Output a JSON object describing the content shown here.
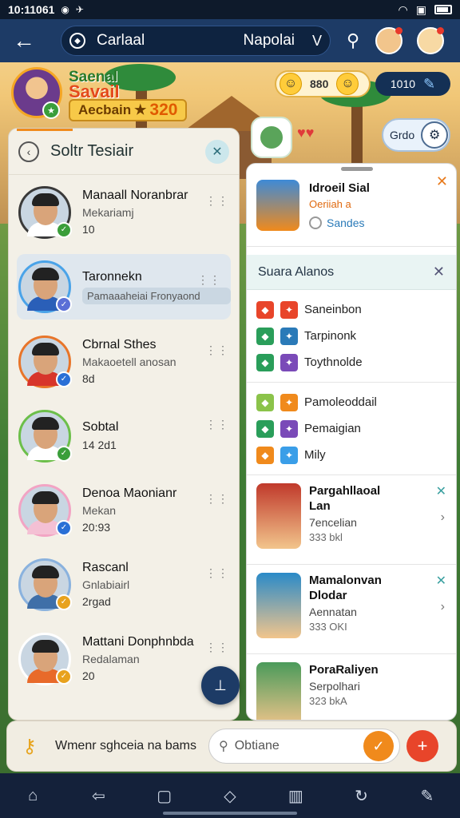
{
  "status_bar": {
    "time": "10:11061"
  },
  "app_bar": {
    "search_left": "Carlaal",
    "search_right": "Napolai",
    "chevron": "V"
  },
  "hud": {
    "name_line1": "Saenal",
    "name_line2": "Savail",
    "level_label": "Aecbain",
    "score": "320",
    "coins": "880",
    "gems": "1010",
    "grid_label": "Grdo",
    "colors": {
      "accent": "#f08a1c",
      "level": "#f7c948"
    }
  },
  "left_panel": {
    "title": "Soltr Tesiair",
    "contacts": [
      {
        "name": "Manaall Noranbrar",
        "sub": "Mekariamj",
        "meta": "10",
        "status_color": "#3a9e3a",
        "ring": "#3a3a3a",
        "shirt": "#ffffff"
      },
      {
        "name": "Taronnekn",
        "sub": "Pamaaaheiai Fronyaond",
        "meta": "",
        "status_color": "#5a6fd6",
        "ring": "#4aa3e8",
        "shirt": "#2a5fb8"
      },
      {
        "name": "Cbrnal Sthes",
        "sub": "Makaoetell anosan",
        "meta": "8d",
        "status_color": "#2a6fd6",
        "ring": "#e8752a",
        "shirt": "#d7352b"
      },
      {
        "name": "Sobtal",
        "sub": "",
        "meta": "14 2d1",
        "status_color": "#3a9e3a",
        "ring": "#6cbf4a",
        "shirt": "#ffffff"
      },
      {
        "name": "Denoa Maonianr",
        "sub": "Mekan",
        "meta": "20:93",
        "status_color": "#2a6fd6",
        "ring": "#f2a4c4",
        "shirt": "#f4c0d4"
      },
      {
        "name": "Rascanl",
        "sub": "Gnlabiairl",
        "meta": "2rgad",
        "status_color": "#e8a21e",
        "ring": "#8ab2de",
        "shirt": "#3f6fa8"
      },
      {
        "name": "Mattani Donphnbda",
        "sub": "Redalaman",
        "meta": "20",
        "status_color": "#e8a21e",
        "ring": "#ffffff",
        "shirt": "#e86a2a"
      }
    ]
  },
  "right_panel": {
    "top": {
      "title": "Idroeil Sial",
      "sub": "Oeriiah a",
      "tag": "Sandes"
    },
    "section_title": "Suara Alanos",
    "group1": [
      {
        "label": "Saneinbon",
        "c1": "#e8452a",
        "c2": "#e8452a"
      },
      {
        "label": "Tarpinonk",
        "c1": "#2a9e5a",
        "c2": "#2a7ab8"
      },
      {
        "label": "Toythnolde",
        "c1": "#2a9e5a",
        "c2": "#7a4ab8"
      }
    ],
    "group2": [
      {
        "label": "Pamoleoddail",
        "c1": "#8bc34a",
        "c2": "#f08a1c"
      },
      {
        "label": "Pemaigian",
        "c1": "#2a9e5a",
        "c2": "#7a4ab8"
      },
      {
        "label": "Mily",
        "c1": "#f08a1c",
        "c2": "#3a9ee8"
      }
    ],
    "cards": [
      {
        "title": "Pargahllaoal",
        "title2": "Lan",
        "sub": "7encelian",
        "meta": "333 bkl",
        "thumb": "#c0392b"
      },
      {
        "title": "Mamalonvan",
        "title2": "Dlodar",
        "sub": "Aennatan",
        "meta": "333 OKI",
        "thumb": "#2a8ac8"
      },
      {
        "title": "PoraRaliyen",
        "title2": "",
        "sub": "Serpolhari",
        "meta": "323 bkA",
        "thumb": "#4a9a5a"
      }
    ]
  },
  "bottom_input": {
    "label": "Wmenr sghceia na bams",
    "placeholder": "Obtiane"
  }
}
